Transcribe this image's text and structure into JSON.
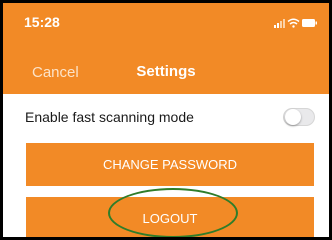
{
  "status_bar": {
    "time": "15:28",
    "icons": [
      "signal-icon",
      "wifi-icon",
      "battery-icon"
    ]
  },
  "nav": {
    "cancel_label": "Cancel",
    "title": "Settings"
  },
  "settings": {
    "fast_scan_label": "Enable fast scanning mode",
    "fast_scan_enabled": false
  },
  "buttons": {
    "change_password": "CHANGE PASSWORD",
    "logout": "LOGOUT"
  },
  "colors": {
    "accent": "#f28a26",
    "highlight": "#2f7d2a"
  }
}
